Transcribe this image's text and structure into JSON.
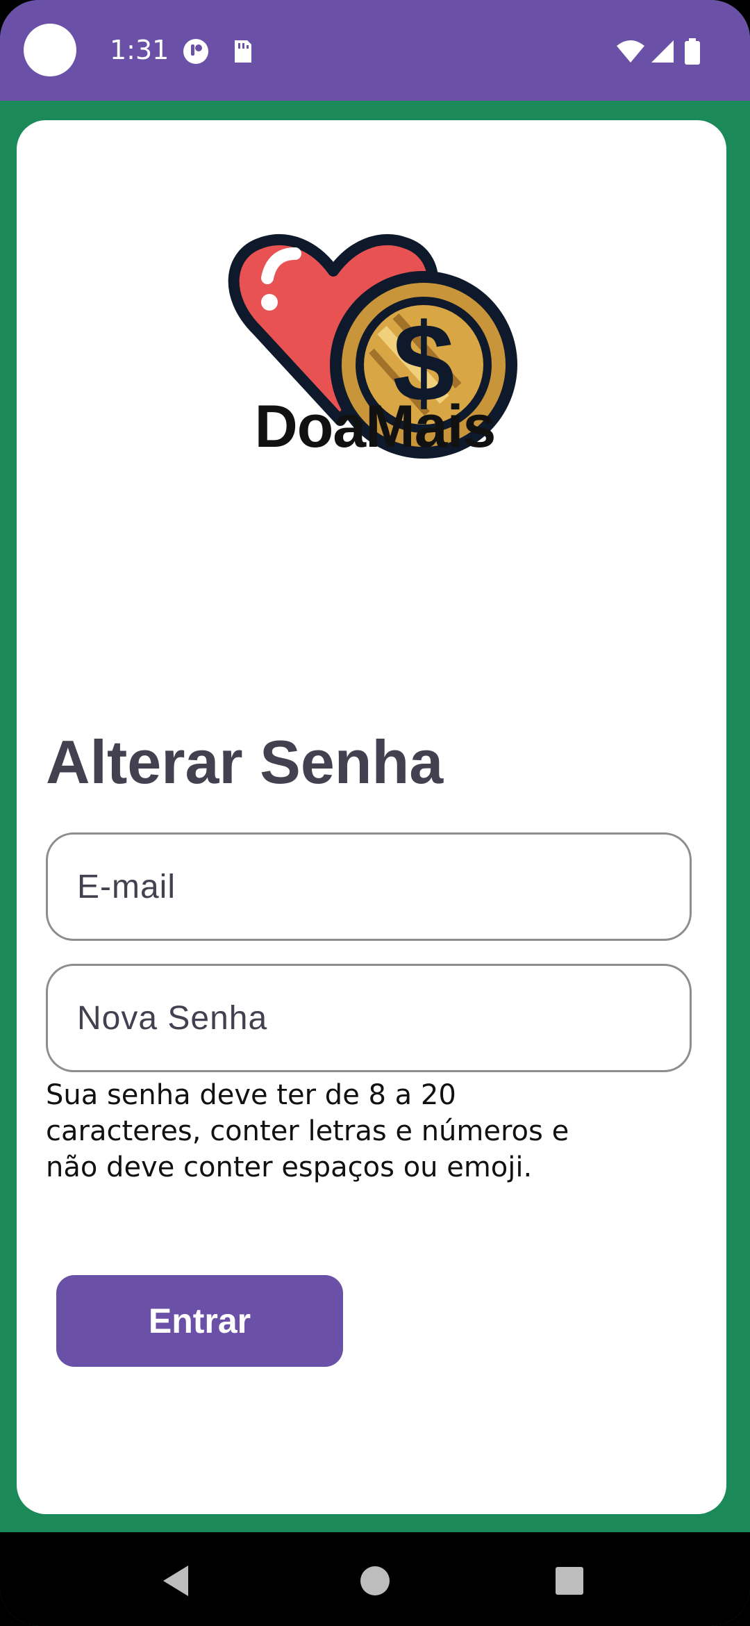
{
  "status_bar": {
    "time": "1:31",
    "icons": [
      "notification-dot",
      "app-indicator-icon",
      "sd-card-icon",
      "wifi-icon",
      "cellular-signal-icon",
      "battery-icon"
    ]
  },
  "brand": {
    "name": "DoaMais",
    "logo": "heart-with-dollar-coin-logo"
  },
  "form": {
    "title": "Alterar Senha",
    "email_placeholder": "E-mail",
    "password_placeholder": "Nova Senha",
    "password_hint": "Sua senha deve ter de 8 a 20 caracteres, conter letras e números e não deve conter espaços ou emoji.",
    "submit_label": "Entrar"
  },
  "navigation": {
    "buttons": [
      "back-icon",
      "home-icon",
      "recents-icon"
    ]
  },
  "colors": {
    "status_bar": "#6a50a7",
    "background": "#1b8a58",
    "card": "#ffffff",
    "primary_button": "#6a50a7",
    "title_text": "#434050"
  }
}
